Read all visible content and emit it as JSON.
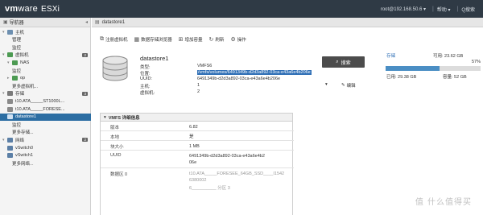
{
  "top_bar": {
    "logo": {
      "vm": "vm",
      "ware": "ware",
      "product": "ESXi"
    },
    "user": "root@192.168.50.6 ▾",
    "help": "帮助 ▾",
    "search_placeholder": "Q搜索"
  },
  "navigator": {
    "title": "导航器",
    "items": [
      {
        "label": "主机",
        "icon": "host-icon",
        "indent": 0,
        "toggle": "▾"
      },
      {
        "label": "管理",
        "icon": "",
        "indent": 2
      },
      {
        "label": "监控",
        "icon": "",
        "indent": 2
      },
      {
        "label": "虚拟机",
        "icon": "vm-icon",
        "indent": 0,
        "toggle": "▾",
        "badge": "2"
      },
      {
        "label": "NAS",
        "icon": "vm-icon",
        "indent": 1,
        "toggle": "▾"
      },
      {
        "label": "监控",
        "icon": "",
        "indent": 2
      },
      {
        "label": "op",
        "icon": "vm-icon",
        "indent": 1,
        "toggle": "▸"
      },
      {
        "label": "更多虚拟机...",
        "icon": "",
        "indent": 2
      },
      {
        "label": "存储",
        "icon": "storage-icon",
        "indent": 0,
        "toggle": "▾",
        "badge": "3"
      },
      {
        "label": "t10.ATA_____ST1000L...",
        "icon": "disk-icon",
        "indent": 1
      },
      {
        "label": "t10.ATA_____FORESE...",
        "icon": "disk-icon",
        "indent": 1
      },
      {
        "label": "datastore1",
        "icon": "datastore-icon",
        "indent": 1,
        "active": true
      },
      {
        "label": "监控",
        "icon": "",
        "indent": 2
      },
      {
        "label": "更多存储...",
        "icon": "",
        "indent": 2
      },
      {
        "label": "网络",
        "icon": "network-icon",
        "indent": 0,
        "toggle": "▾",
        "badge": "2"
      },
      {
        "label": "vSwitch0",
        "icon": "switch-icon",
        "indent": 1
      },
      {
        "label": "vSwitch1",
        "icon": "switch-icon",
        "indent": 1
      },
      {
        "label": "更多网络...",
        "icon": "",
        "indent": 2
      }
    ]
  },
  "main": {
    "header": "datastore1",
    "toolbar": [
      {
        "label": "注册虚拟机",
        "icon": "register-vm-icon"
      },
      {
        "label": "数据存储浏览器",
        "icon": "browser-icon"
      },
      {
        "label": "增加容量",
        "icon": "increase-capacity-icon"
      },
      {
        "label": "刷新",
        "icon": "refresh-icon"
      },
      {
        "label": "操作",
        "icon": "gear-icon"
      }
    ],
    "datastore": {
      "name": "datastore1",
      "type_key": "类型:",
      "type_val": "VMFS6",
      "location_key": "位置:",
      "location_val": "/vmfs/volumes/6491349b-d2d3a892-03ca-e43a6e4b206e",
      "uuid_key": "UUID:",
      "uuid_val": "6491349b-d2d3a892-03ca-e43a6e4b206e",
      "hosts_key": "主机:",
      "hosts_val": "1",
      "vms_key": "虚拟机:",
      "vms_val": "2"
    },
    "search_button": "搜索",
    "actions": [
      {
        "label": "▾"
      },
      {
        "label": "编辑"
      }
    ],
    "capacity": {
      "storage_label": "存储",
      "free_label": "可用: 23.62 GB",
      "used_pct": "57%",
      "used_fraction": 0.57,
      "used_label": "已用: 29.38 GB",
      "total_label": "容量: 52 GB"
    },
    "vmfs_panel": {
      "title": "VMFS 详细信息",
      "rows": [
        {
          "key": "版本",
          "val": "6.82"
        },
        {
          "key": "本地",
          "val": "是"
        },
        {
          "key": "块大小",
          "val": "1 MB"
        },
        {
          "key": "UUID",
          "val": "6491349b-d2d3a892-03ca-e43a6e4b206e"
        },
        {
          "key": "数据区 0",
          "val": "t10.ATA_____FORESEE_64GB_SSD____I15426380002",
          "val2": "6__________ 分区 3"
        }
      ]
    }
  },
  "watermark": "值 什么值得买",
  "colors": {
    "topbar": "#2f3a45",
    "active_nav": "#2c6ea3",
    "highlight": "#2f6fb6",
    "capacity_fill": "#4a8ec4"
  }
}
